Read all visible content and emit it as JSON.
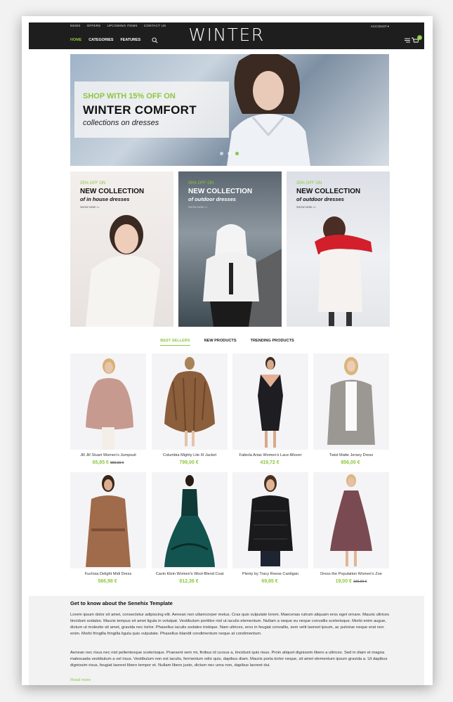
{
  "header": {
    "top_links": [
      "NEWS",
      "OFFERS",
      "UPCOMING ITEMS",
      "CONTACT US"
    ],
    "logo": "WINTER",
    "account": "ACCOUNT ▾",
    "nav": [
      "HOME",
      "CATEGORIES",
      "FEATURES"
    ],
    "cart_count": "0"
  },
  "hero": {
    "kicker": "SHOP WITH 15% OFF ON",
    "title": "WINTER COMFORT",
    "subtitle": "collections on dresses"
  },
  "banners": [
    {
      "kicker": "35% OFF ON",
      "title": "NEW COLLECTION",
      "sub": "of in house dresses",
      "link": "SHOW NOW >>"
    },
    {
      "kicker": "35% OFF ON",
      "title": "NEW COLLECTION",
      "sub": "of outdoor dresses",
      "link": "SHOW NOW >>"
    },
    {
      "kicker": "35% OFF ON",
      "title": "NEW COLLECTION",
      "sub": "of outdoor dresses",
      "link": "SHOW NOW >>"
    }
  ],
  "tabs": [
    "BEST SELLERS",
    "NEW PRODUCTS",
    "TRENDING PRODUCTS"
  ],
  "products": [
    {
      "name": "Jill Jill Stuart Women's Jumpsuit",
      "price": "65,85 €",
      "old_price": "899,99 €"
    },
    {
      "name": "Columbia Mighty Lite III Jacket",
      "price": "799,00 €",
      "old_price": ""
    },
    {
      "name": "Fabiola Arias Women's Lace Allover",
      "price": "419,72 €",
      "old_price": ""
    },
    {
      "name": "Twist Matte Jersey Dress",
      "price": "856,00 €",
      "old_price": ""
    },
    {
      "name": "Fuchsia Delight Midi Dress",
      "price": "566,98 €",
      "old_price": ""
    },
    {
      "name": "Cavin Klein Women's Wool-Blend Coat",
      "price": "812,36 €",
      "old_price": ""
    },
    {
      "name": "Plenty by Tracy Reese Cardigan",
      "price": "69,85 €",
      "old_price": ""
    },
    {
      "name": "Dress the Population Women's Zoe",
      "price": "19,00 €",
      "old_price": "190,00 €"
    }
  ],
  "about": {
    "title": "Get to know about the Senehix Template",
    "p1": "Lorem ipsum dolor sit amet, consectetur adipiscing elit. Aenean non ullamcorper metus. Cras quis vulputate lorem. Maecenas rutrum aliquam eros eget ornare. Mauris ultrices tincidunt sodales. Mauris tempus sit amet ligula in volutpat. Vestibulum porttitor nisl ut iaculis elementum. Nullam a neque eu neque convallis scelerisque. Morbi enim augue, dictum ut molestie sit amet, gravida nec tortor. Phasellus iaculis sodales tristique. Nam ultrices, eros in feugiat convallis, sem velit laoreet ipsum, ac pulvinar neque erat non enim. Morbi fringilla fringilla ligula quis vulputate. Phasellus blandit condimentum neque at condimentum.",
    "p2": "Aenean nec risus nec nisl pellentesque scelerisque. Praesent sem mi, finibus id cursus a, tincidunt quis risus. Proin aliquet dignissim libero a ultrices. Sed in diam et magna malesuada vestibulum a vel risus. Vestibulum non est iaculis, fermentum odio quis, dapibus diam. Mauris porta tortor neque, sit amet elementum ipsum gravida a. Ut dapibus dignissim risus, feugiat laoreet libero tempor et. Nullam libero justo, dictum nec urna non, dapibus laoreet dui.",
    "read_more": "Read more"
  },
  "colors": {
    "accent": "#8cc63f",
    "header_bg": "#1e1e1e"
  }
}
